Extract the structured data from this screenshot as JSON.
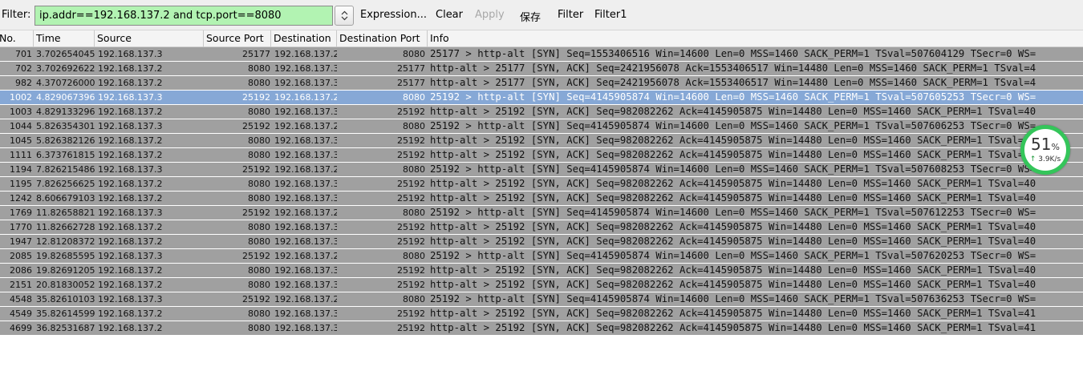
{
  "filter": {
    "label": "Filter:",
    "value": "ip.addr==192.168.137.2 and tcp.port==8080",
    "spin_icon": "updown-chevron-icon",
    "expression": "Expression...",
    "clear": "Clear",
    "apply": "Apply",
    "save": "保存",
    "filter_btn": "Filter",
    "filter1_btn": "Filter1"
  },
  "columns": [
    "No.",
    "Time",
    "Source",
    "Source Port",
    "Destination",
    "Destination Port",
    "Info"
  ],
  "colors": {
    "row": "#a0a0a0",
    "selected_row": "#86a8d6",
    "filter_ok": "#b2f3b2",
    "highlight": "#a8a80a",
    "widget_ring": "#34c55a"
  },
  "packets": [
    {
      "no": "701",
      "time": "3.702654045",
      "src": "192.168.137.3",
      "sport": "25177",
      "dst": "192.168.137.2",
      "dport": "8080",
      "info": "25177 > http-alt [SYN] Seq=1553406516 Win=14600 Len=0 MSS=1460 SACK_PERM=1 TSval=507604129 TSecr=0 WS="
    },
    {
      "no": "702",
      "time": "3.702692622",
      "src": "192.168.137.2",
      "sport": "8080",
      "dst": "192.168.137.3",
      "dport": "25177",
      "info": "http-alt > 25177 [SYN, ACK] Seq=2421956078 Ack=1553406517 Win=14480 Len=0 MSS=1460 SACK_PERM=1 TSval=4"
    },
    {
      "no": "982",
      "time": "4.370726000",
      "src": "192.168.137.2",
      "sport": "8080",
      "dst": "192.168.137.3",
      "dport": "25177",
      "info": "http-alt > 25177 [SYN, ACK] Seq=2421956078 Ack=1553406517 Win=14480 Len=0 MSS=1460 SACK_PERM=1 TSval=4"
    },
    {
      "no": "1002",
      "time": "4.829067396",
      "src": "192.168.137.3",
      "sport": "25192",
      "dst": "192.168.137.2",
      "dport": "8080",
      "info": "25192 > http-alt [SYN] Seq=4145905874 Win=14600 Len=0 MSS=1460 SACK_PERM=1 TSval=507605253 TSecr=0 WS="
    },
    {
      "no": "1003",
      "time": "4.829133296",
      "src": "192.168.137.2",
      "sport": "8080",
      "dst": "192.168.137.3",
      "dport": "25192",
      "info": "http-alt > 25192 [SYN, ACK] Seq=982082262 Ack=4145905875 Win=14480 Len=0 MSS=1460 SACK_PERM=1 TSval=40"
    },
    {
      "no": "1044",
      "time": "5.826354301",
      "src": "192.168.137.3",
      "sport": "25192",
      "dst": "192.168.137.2",
      "dport": "8080",
      "info": "25192 > http-alt [SYN] Seq=4145905874 Win=14600 Len=0 MSS=1460 SACK_PERM=1 TSval=507606253 TSecr=0 WS="
    },
    {
      "no": "1045",
      "time": "5.826382126",
      "src": "192.168.137.2",
      "sport": "8080",
      "dst": "192.168.137.3",
      "dport": "25192",
      "info": "http-alt > 25192 [SYN, ACK] Seq=982082262 Ack=4145905875 Win=14480 Len=0 MSS=1460 SACK_PERM=1 TSval=40"
    },
    {
      "no": "1111",
      "time": "6.373761815",
      "src": "192.168.137.2",
      "sport": "8080",
      "dst": "192.168.137.3",
      "dport": "25192",
      "info": "http-alt > 25192 [SYN, ACK] Seq=982082262 Ack=4145905875 Win=14480 Len=0 MSS=1460 SACK_PERM=1 TSval=40"
    },
    {
      "no": "1194",
      "time": "7.826215486",
      "src": "192.168.137.3",
      "sport": "25192",
      "dst": "192.168.137.2",
      "dport": "8080",
      "info": "25192 > http-alt [SYN] Seq=4145905874 Win=14600 Len=0 MSS=1460 SACK_PERM=1 TSval=507608253 TSecr=0 WS="
    },
    {
      "no": "1195",
      "time": "7.826256625",
      "src": "192.168.137.2",
      "sport": "8080",
      "dst": "192.168.137.3",
      "dport": "25192",
      "info": "http-alt > 25192 [SYN, ACK] Seq=982082262 Ack=4145905875 Win=14480 Len=0 MSS=1460 SACK_PERM=1 TSval=40"
    },
    {
      "no": "1242",
      "time": "8.606679103",
      "src": "192.168.137.2",
      "sport": "8080",
      "dst": "192.168.137.3",
      "dport": "25192",
      "info": "http-alt > 25192 [SYN, ACK] Seq=982082262 Ack=4145905875 Win=14480 Len=0 MSS=1460 SACK_PERM=1 TSval=40"
    },
    {
      "no": "1769",
      "time": "11.826588215",
      "src": "192.168.137.3",
      "sport": "25192",
      "dst": "192.168.137.2",
      "dport": "8080",
      "info": "25192 > http-alt [SYN] Seq=4145905874 Win=14600 Len=0 MSS=1460 SACK_PERM=1 TSval=507612253 TSecr=0 WS="
    },
    {
      "no": "1770",
      "time": "11.826627286",
      "src": "192.168.137.2",
      "sport": "8080",
      "dst": "192.168.137.3",
      "dport": "25192",
      "info": "http-alt > 25192 [SYN, ACK] Seq=982082262 Ack=4145905875 Win=14480 Len=0 MSS=1460 SACK_PERM=1 TSval=40"
    },
    {
      "no": "1947",
      "time": "12.812083720",
      "src": "192.168.137.2",
      "sport": "8080",
      "dst": "192.168.137.3",
      "dport": "25192",
      "info": "http-alt > 25192 [SYN, ACK] Seq=982082262 Ack=4145905875 Win=14480 Len=0 MSS=1460 SACK_PERM=1 TSval=40"
    },
    {
      "no": "2085",
      "time": "19.826855957",
      "src": "192.168.137.3",
      "sport": "25192",
      "dst": "192.168.137.2",
      "dport": "8080",
      "info": "25192 > http-alt [SYN] Seq=4145905874 Win=14600 Len=0 MSS=1460 SACK_PERM=1 TSval=507620253 TSecr=0 WS="
    },
    {
      "no": "2086",
      "time": "19.826912055",
      "src": "192.168.137.2",
      "sport": "8080",
      "dst": "192.168.137.3",
      "dport": "25192",
      "info": "http-alt > 25192 [SYN, ACK] Seq=982082262 Ack=4145905875 Win=14480 Len=0 MSS=1460 SACK_PERM=1 TSval=40"
    },
    {
      "no": "2151",
      "time": "20.818300527",
      "src": "192.168.137.2",
      "sport": "8080",
      "dst": "192.168.137.3",
      "dport": "25192",
      "info": "http-alt > 25192 [SYN, ACK] Seq=982082262 Ack=4145905875 Win=14480 Len=0 MSS=1460 SACK_PERM=1 TSval=40"
    },
    {
      "no": "4548",
      "time": "35.826101033",
      "src": "192.168.137.3",
      "sport": "25192",
      "dst": "192.168.137.2",
      "dport": "8080",
      "info": "25192 > http-alt [SYN] Seq=4145905874 Win=14600 Len=0 MSS=1460 SACK_PERM=1 TSval=507636253 TSecr=0 WS="
    },
    {
      "no": "4549",
      "time": "35.826145990",
      "src": "192.168.137.2",
      "sport": "8080",
      "dst": "192.168.137.3",
      "dport": "25192",
      "info": "http-alt > 25192 [SYN, ACK] Seq=982082262 Ack=4145905875 Win=14480 Len=0 MSS=1460 SACK_PERM=1 TSval=41"
    },
    {
      "no": "4699",
      "time": "36.825316874",
      "src": "192.168.137.2",
      "sport": "8080",
      "dst": "192.168.137.3",
      "dport": "25192",
      "info": "http-alt > 25192 [SYN, ACK] Seq=982082262 Ack=4145905875 Win=14480 Len=0 MSS=1460 SACK_PERM=1 TSval=41"
    }
  ],
  "selected_row": 3,
  "speed_widget": {
    "percent": "51",
    "percent_unit": "%",
    "arrow_icon": "up-arrow-icon",
    "arrow": "↑",
    "rate": "3.9K/s"
  }
}
